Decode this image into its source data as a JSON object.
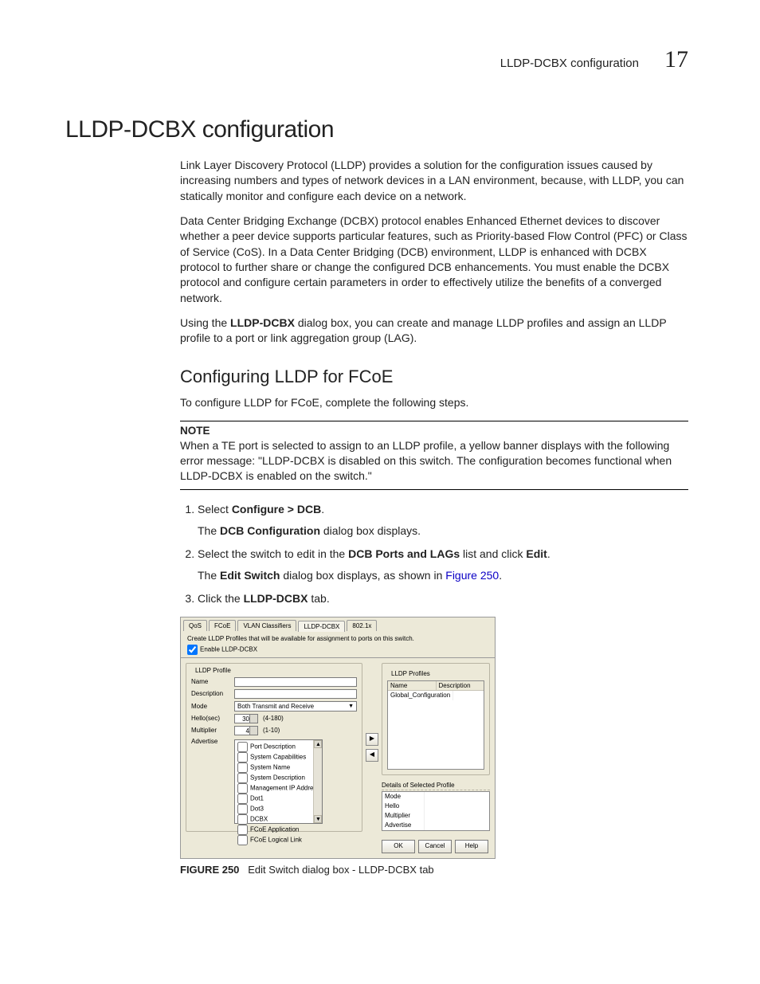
{
  "runningHead": {
    "title": "LLDP-DCBX configuration",
    "chapter": "17"
  },
  "h1": "LLDP-DCBX configuration",
  "para1": "Link Layer Discovery Protocol (LLDP) provides a solution for the configuration issues caused by increasing numbers and types of network devices in a LAN environment, because, with LLDP, you can statically monitor and configure each device on a network.",
  "para2": "Data Center Bridging Exchange (DCBX) protocol enables Enhanced Ethernet devices to discover whether a peer device supports particular features, such as Priority-based Flow Control (PFC) or Class of Service (CoS). In a Data Center Bridging (DCB) environment, LLDP is enhanced with DCBX protocol to further share or change the configured DCB enhancements. You must enable the DCBX protocol and configure certain parameters in order to effectively utilize the benefits of a converged network.",
  "para3_lead": "Using the ",
  "para3_bold": "LLDP-DCBX",
  "para3_tail": " dialog box, you can create and manage LLDP profiles and assign an LLDP profile to a port or link aggregation group (LAG).",
  "h2": "Configuring LLDP for FCoE",
  "para4": "To configure LLDP for FCoE, complete the following steps.",
  "note_label": "NOTE",
  "note_text": "When a TE port is selected to assign to an LLDP profile, a yellow banner displays with the following error message: \"LLDP-DCBX is disabled on this switch. The configuration becomes functional when LLDP-DCBX is enabled on the switch.\"",
  "steps": {
    "s1_a": "Select ",
    "s1_b": "Configure > DCB",
    "s1_c": ".",
    "s1_sub_a": "The ",
    "s1_sub_b": "DCB Configuration",
    "s1_sub_c": " dialog box displays.",
    "s2_a": "Select the switch to edit in the ",
    "s2_b": "DCB Ports and LAGs",
    "s2_c": " list and click ",
    "s2_d": "Edit",
    "s2_e": ".",
    "s2_sub_a": "The ",
    "s2_sub_b": "Edit Switch",
    "s2_sub_c": " dialog box displays, as shown in ",
    "s2_sub_link": "Figure 250",
    "s2_sub_d": ".",
    "s3_a": "Click the ",
    "s3_b": "LLDP-DCBX",
    "s3_c": " tab."
  },
  "dialog": {
    "tabs": [
      "QoS",
      "FCoE",
      "VLAN Classifiers",
      "LLDP-DCBX",
      "802.1x"
    ],
    "active_tab": 3,
    "instruction": "Create LLDP Profiles that will be available for assignment to ports on this switch.",
    "enable_label": "Enable LLDP-DCBX",
    "left_panel_title": "LLDP Profile",
    "labels": {
      "name": "Name",
      "description": "Description",
      "mode": "Mode",
      "hello": "Hello(sec)",
      "multiplier": "Multiplier",
      "advertise": "Advertise"
    },
    "mode_value": "Both Transmit and Receive",
    "hello_value": "30",
    "hello_hint": "(4-180)",
    "multiplier_value": "4",
    "multiplier_hint": "(1-10)",
    "advertise_items": [
      "Port Description",
      "System Capabilities",
      "System Name",
      "System Description",
      "Management IP Address",
      "Dot1",
      "Dot3",
      "DCBX",
      "FCoE Application",
      "FCoE Logical Link"
    ],
    "right_panel_title": "LLDP Profiles",
    "profiles_table": {
      "headers": [
        "Name",
        "Description"
      ],
      "rows": [
        [
          "Global_Configuration",
          ""
        ]
      ]
    },
    "details_title": "Details of Selected Profile",
    "details_rows": [
      "Mode",
      "Hello",
      "Multiplier",
      "Advertise"
    ],
    "buttons": {
      "ok": "OK",
      "cancel": "Cancel",
      "help": "Help"
    }
  },
  "figure_caption_lead": "FIGURE 250",
  "figure_caption_tail": "Edit Switch dialog box - LLDP-DCBX tab"
}
